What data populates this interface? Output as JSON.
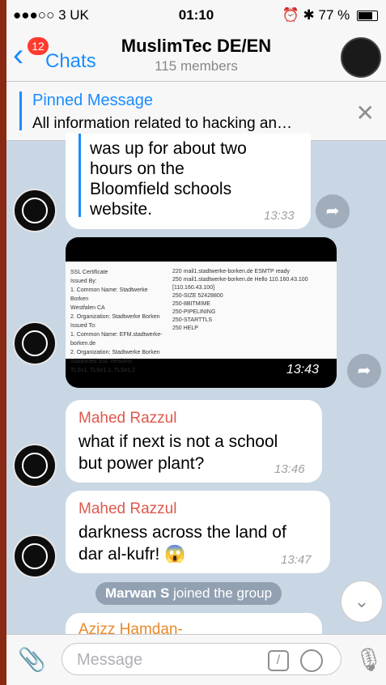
{
  "status_bar": {
    "carrier": "●●●○○ 3 UK",
    "time": "01:10",
    "battery": "77 %"
  },
  "header": {
    "back_label": "Chats",
    "unread_badge": "12",
    "title": "MuslimTec DE/EN",
    "subtitle": "115 members"
  },
  "pinned": {
    "title": "Pinned Message",
    "text": "All information related to hacking an…"
  },
  "messages": [
    {
      "lines": [
        "was up for about two",
        "hours on the",
        "Bloomfield schools",
        "website."
      ],
      "time": "13:33"
    },
    {
      "type": "photo",
      "time": "13:43",
      "doc_left": [
        "SSL Certificate",
        "Issued By:",
        "1. Common Name: Stadtwerke Borken",
        "Westfalen CA",
        "2. Organization: Stadtwerke Borken",
        "Issued To:",
        "1. Common Name: EFM.stadtwerke-",
        "borken.de",
        "2. Organization: Stadtwerke Borken",
        "Supported SSL Versions",
        "TLSv1, TLSv1.1, TLSv1.2"
      ],
      "doc_right": [
        "220 mail1.stadtwerke-borken.de ESMTP ready",
        "250 mail1.stadtwerke-borken.de Hello 110.160.43.100 [110.160.43.100]",
        "250-SIZE 52428800",
        "250-8BITMIME",
        "250-PIPELINING",
        "250-STARTTLS",
        "250 HELP"
      ]
    },
    {
      "sender": "Mahed Razzul",
      "lines": [
        "what if next is not a school",
        "but power plant?"
      ],
      "time": "13:46"
    },
    {
      "sender": "Mahed Razzul",
      "lines": [
        "darkness across the land of",
        "dar al-kufr! 😱"
      ],
      "time": "13:47"
    }
  ],
  "service_message": {
    "user": "Marwan S",
    "text": "joined the group"
  },
  "partial_sender": "Azizz Hamdan-",
  "input": {
    "placeholder": "Message"
  },
  "colors": {
    "accent": "#1a8cff",
    "sender": "#e0574b",
    "badge": "#ff3b30"
  }
}
